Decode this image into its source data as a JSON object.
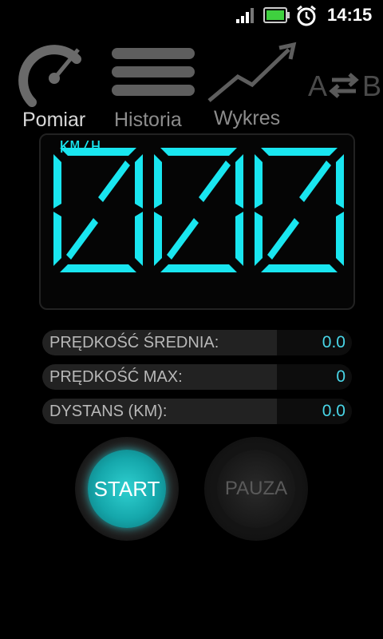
{
  "status_bar": {
    "time": "14:15",
    "icons": [
      "signal-icon",
      "battery-icon",
      "alarm-clock-icon"
    ]
  },
  "nav": {
    "items": [
      {
        "label": "Pomiar",
        "icon": "speedometer-icon",
        "active": true
      },
      {
        "label": "Historia",
        "icon": "list-icon",
        "active": false
      },
      {
        "label": "Wykres",
        "icon": "chart-line-icon",
        "active": false
      }
    ],
    "swap_icon": "a-to-b-swap-icon"
  },
  "display": {
    "digits": "000",
    "unit": "KM/H",
    "color": "#19e6f0"
  },
  "stats": [
    {
      "label": "PRĘDKOŚĆ ŚREDNIA:",
      "value": "0.0"
    },
    {
      "label": "PRĘDKOŚĆ MAX:",
      "value": "0"
    },
    {
      "label": "DYSTANS (KM):",
      "value": "0.0"
    }
  ],
  "controls": {
    "start_label": "START",
    "pause_label": "PAUZA"
  },
  "colors": {
    "accent": "#19e6f0",
    "value_text": "#49d6e8",
    "start_button": "#15a7ab"
  }
}
